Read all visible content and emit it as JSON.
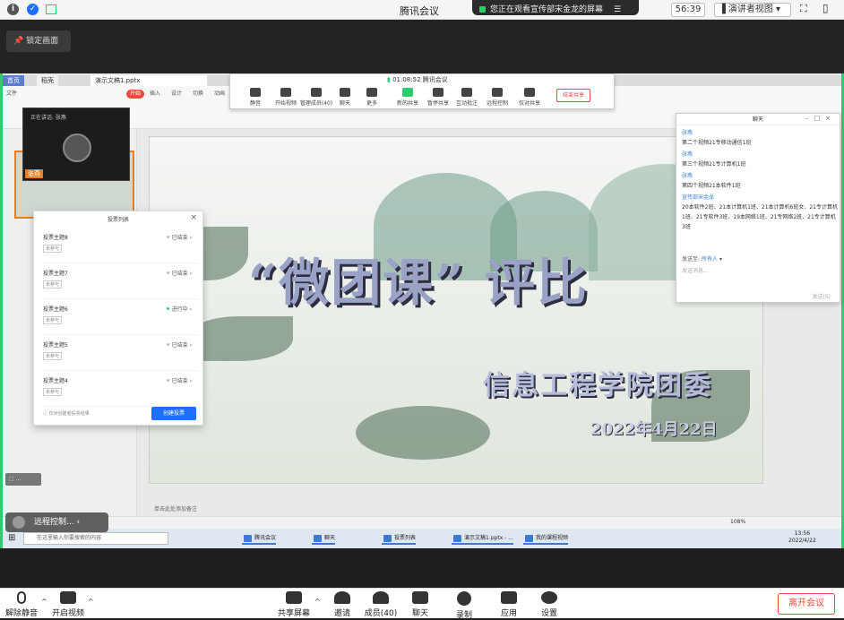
{
  "window": {
    "title": "腾讯会议",
    "share_notice": "您正在观看宣传部宋金龙的屏幕",
    "timer": "56:39",
    "view_button": "演讲者视图"
  },
  "lock_button": "锁定画面",
  "meeting_toolbar": {
    "time": "01:08:52",
    "name": "腾讯会议",
    "buttons": [
      "静音",
      "开始视频",
      "管理成员(40)",
      "聊天",
      "更多",
      "新的共享",
      "暂停共享",
      "互动批注",
      "远程控制",
      "仅对共享"
    ],
    "end_share": "结束共享"
  },
  "ppt": {
    "tabs": [
      "首页",
      "稻壳",
      "演示文稿1.pptx"
    ],
    "ribbon": [
      "文件",
      "开始",
      "插入",
      "设计",
      "切换",
      "动画"
    ],
    "speaker": {
      "label": "正在讲话: 张燕",
      "name": "张燕"
    },
    "slide": {
      "title": "“微团课” 评比",
      "subtitle": "信息工程学院团委",
      "date": "2022年4月22日"
    },
    "notes_placeholder": "单击此处添加备注"
  },
  "vote_panel": {
    "header": "投票列表",
    "items": [
      {
        "title": "投票主题8",
        "tag": "未参与",
        "status": "已结束"
      },
      {
        "title": "投票主题7",
        "tag": "未参与",
        "status": "已结束"
      },
      {
        "title": "投票主题6",
        "tag": "未参与",
        "status": "进行中"
      },
      {
        "title": "投票主题5",
        "tag": "未参与",
        "status": "已结束"
      },
      {
        "title": "投票主题4",
        "tag": "未参与",
        "status": "已结束"
      }
    ],
    "footer": "仅对创建者投票结果",
    "create_button": "创建投票"
  },
  "chat": {
    "title": "聊天",
    "messages": [
      {
        "name": "张燕",
        "text": "第二个视频21专移动通信1班"
      },
      {
        "name": "张燕",
        "text": "第三个视频21专计算机1班"
      },
      {
        "name": "张燕",
        "text": "第四个视频21本软件1班"
      },
      {
        "name": "宣传部宋金龙",
        "text": "20本软件2班、21本计算机1班、21本计算机6班女、21专计算机1班、21专软件3班、19本网络1班、21专网络2班、21专计算机3班"
      }
    ],
    "send_to_label": "发送至:",
    "send_to_value": "所有人",
    "input_placeholder": "发送消息...",
    "send_button": "发送(S)"
  },
  "taskbar": {
    "search_placeholder": "在这里输入你要搜索的内容",
    "apps": [
      "腾讯会议",
      "聊天",
      "投票列表",
      "演示文稿1.pptx - ...",
      "我的课程视频"
    ],
    "time": "13:56",
    "date": "2022/4/22"
  },
  "statusbar": {
    "zoom": "108%"
  },
  "overlay": {
    "remote_pill": "远程控制..."
  },
  "bottom_bar": {
    "buttons": [
      "解除静音",
      "开启视频",
      "共享屏幕",
      "邀请",
      "成员(40)",
      "聊天",
      "录制",
      "应用",
      "设置"
    ],
    "leave": "离开会议"
  },
  "colors": {
    "accent_green": "#2ecc71",
    "accent_blue": "#1e6fff",
    "danger": "#e74c3c"
  }
}
